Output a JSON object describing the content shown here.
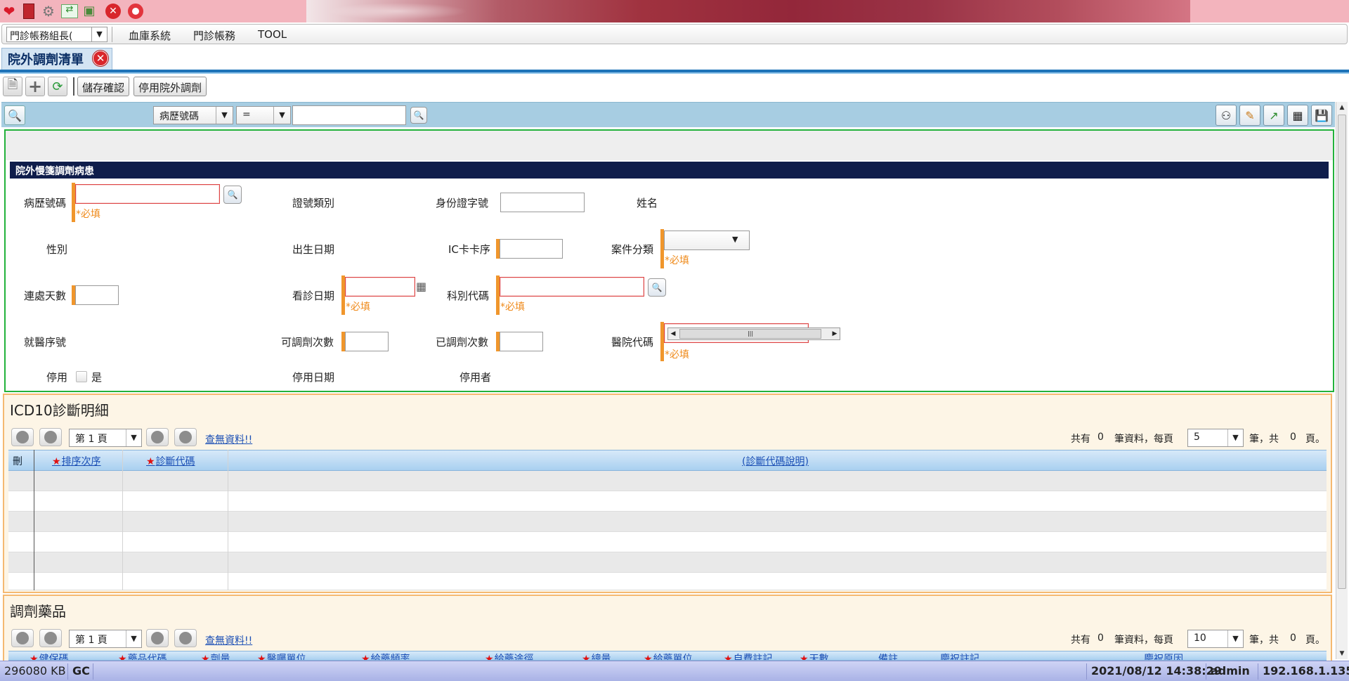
{
  "menubar": {
    "role_value": "門診帳務組長(",
    "items": [
      "血庫系統",
      "門診帳務",
      "TOOL"
    ]
  },
  "tab": {
    "title": "院外調劑清單"
  },
  "toolbar": {
    "save_confirm": "儲存確認",
    "disable_outside": "停用院外調劑"
  },
  "search": {
    "field": "病歷號碼",
    "operator": "=",
    "value": ""
  },
  "form": {
    "section_title": "院外慢箋調劑病患",
    "required_hint": "*必填",
    "labels": {
      "chart_no": "病歷號碼",
      "cert_type": "證號類別",
      "id_no": "身份證字號",
      "name": "姓名",
      "sex": "性別",
      "birth_date": "出生日期",
      "ic_seq": "IC卡卡序",
      "case_type": "案件分類",
      "days": "連處天數",
      "visit_date": "看診日期",
      "dept_code": "科別代碼",
      "visit_seq": "就醫序號",
      "allow_count": "可調劑次數",
      "done_count": "已調劑次數",
      "hospital_code": "醫院代碼",
      "disabled": "停用",
      "disabled_yes": "是",
      "disabled_date": "停用日期",
      "disabled_by": "停用者"
    }
  },
  "icd_grid": {
    "title": "ICD10診斷明細",
    "page": "第 1 頁",
    "nodata": "查無資料!!",
    "total_pre": "共有",
    "total": "0",
    "per_page_txt": "筆資料，每頁",
    "per_page": "5",
    "pages_pre": "筆，共",
    "pages": "0",
    "pages_suf": "頁。",
    "columns": [
      "刪",
      "排序次序",
      "診斷代碼",
      "(診斷代碼說明)"
    ]
  },
  "drug_grid": {
    "title": "調劑藥品",
    "page": "第 1 頁",
    "nodata": "查無資料!!",
    "total_pre": "共有",
    "total": "0",
    "per_page_txt": "筆資料，每頁",
    "per_page": "10",
    "pages_pre": "筆，共",
    "pages": "0",
    "pages_suf": "頁。",
    "columns": [
      "健保碼",
      "藥品代碼",
      "劑量",
      "醫囑單位",
      "給藥頻率",
      "給藥途徑",
      "總量",
      "給藥單位",
      "自費註記",
      "天數",
      "備註",
      "慶祝註記",
      "慶祝原因"
    ]
  },
  "status": {
    "memory": "296080 KB",
    "gc": "GC",
    "datetime": "2021/08/12 14:38:29",
    "user": "admin",
    "ip": "192.168.1.135"
  }
}
